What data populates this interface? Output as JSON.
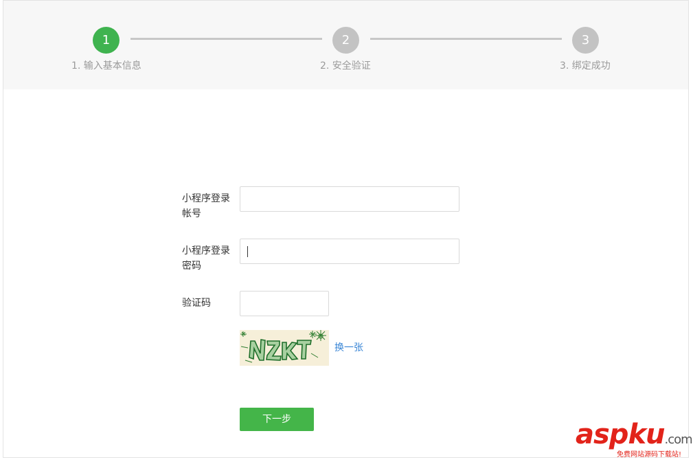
{
  "steps": [
    {
      "number": "1",
      "label": "1. 输入基本信息",
      "state": "active"
    },
    {
      "number": "2",
      "label": "2. 安全验证",
      "state": "inactive"
    },
    {
      "number": "3",
      "label": "3. 绑定成功",
      "state": "inactive"
    }
  ],
  "form": {
    "account_label": "小程序登录帐号",
    "account_label_line1": "小程序登录",
    "account_label_line2": "帐号",
    "account_value": "",
    "password_label_line1": "小程序登录",
    "password_label_line2": "密码",
    "password_value": "",
    "captcha_label": "验证码",
    "captcha_value": "",
    "captcha_text": "nZKT",
    "refresh_link": "换一张",
    "next_button": "下一步"
  },
  "colors": {
    "accent_green": "#44b549",
    "step_active": "#3fb34f",
    "step_inactive": "#c3c3c3",
    "link_blue": "#3a86d6"
  },
  "watermark": {
    "main_a": "asp",
    "main_b": "ku",
    "suffix": ".com",
    "sub": "免费网站源码下载站!"
  }
}
